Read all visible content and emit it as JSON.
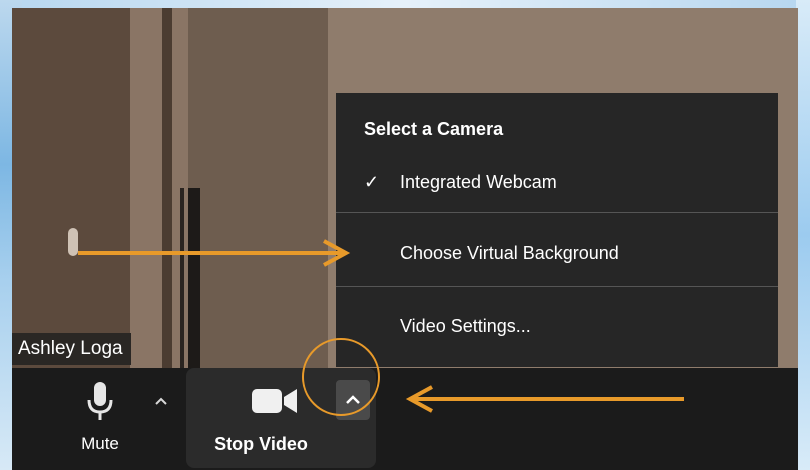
{
  "participant": {
    "name": "Ashley Loga"
  },
  "camera_menu": {
    "header": "Select a Camera",
    "items": [
      {
        "label": "Integrated Webcam",
        "checked": true
      },
      {
        "label": "Choose Virtual Background",
        "checked": false
      },
      {
        "label": "Video Settings...",
        "checked": false
      }
    ]
  },
  "toolbar": {
    "mute_label": "Mute",
    "stop_video_label": "Stop Video"
  },
  "icons": {
    "mute": "microphone-icon",
    "mute_caret": "chevron-up-icon",
    "video": "video-camera-icon",
    "video_caret": "chevron-up-icon",
    "check": "checkmark-icon"
  },
  "colors": {
    "menu_bg": "#262626",
    "toolbar_bg": "#1b1b1b",
    "annotation": "#e89a2a"
  }
}
